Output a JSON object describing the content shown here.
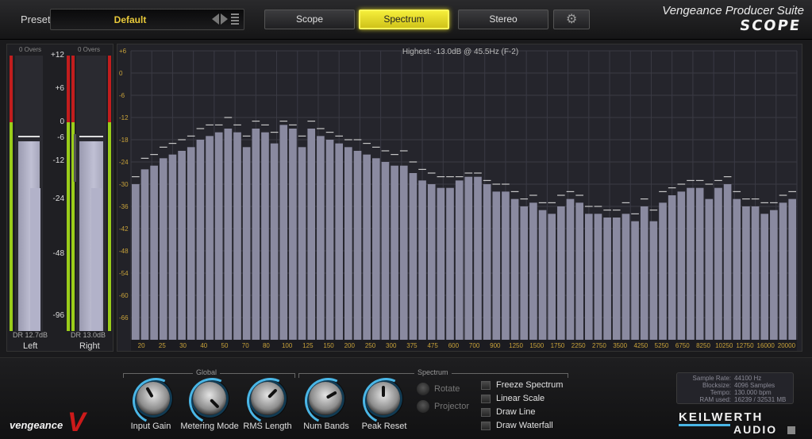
{
  "header": {
    "preset_label": "Preset",
    "preset_name": "Default",
    "tabs": [
      {
        "label": "Scope",
        "active": false
      },
      {
        "label": "Spectrum",
        "active": true
      },
      {
        "label": "Stereo",
        "active": false
      }
    ],
    "settings_icon": "gear-icon",
    "suite_title": "Vengeance Producer Suite",
    "product_logo": "SCOPE"
  },
  "meters": {
    "overs_left": "0 Overs",
    "overs_right": "0 Overs",
    "scale": [
      {
        "label": "+12",
        "db": 12
      },
      {
        "label": "+6",
        "db": 6
      },
      {
        "label": "0",
        "db": 0
      },
      {
        "label": "-6",
        "db": -6
      },
      {
        "label": "-12",
        "db": -12
      },
      {
        "label": "-24",
        "db": -24
      },
      {
        "label": "-48",
        "db": -48
      },
      {
        "label": "-96",
        "db": -96
      }
    ],
    "left": {
      "label": "Left",
      "dr": "DR 12.7dB",
      "level_fraction": 0.69,
      "rms_fraction": 0.52,
      "peak_fraction": 0.71
    },
    "right": {
      "label": "Right",
      "dr": "DR 13.0dB",
      "level_fraction": 0.69,
      "rms_fraction": 0.52,
      "peak_fraction": 0.71
    },
    "colors": {
      "red": "#c21d1d",
      "green": "#9acd1a"
    }
  },
  "spectrum": {
    "highest": "Highest: -13.0dB @ 45.5Hz (F-2)",
    "y_ticks": [
      "+6",
      "0",
      "-6",
      "-12",
      "-18",
      "-24",
      "-30",
      "-36",
      "-42",
      "-48",
      "-54",
      "-60",
      "-66"
    ],
    "x_ticks": [
      "20",
      "25",
      "30",
      "40",
      "50",
      "70",
      "80",
      "100",
      "125",
      "150",
      "200",
      "250",
      "300",
      "375",
      "475",
      "600",
      "700",
      "900",
      "1250",
      "1500",
      "1750",
      "2250",
      "2750",
      "3500",
      "4250",
      "5250",
      "6750",
      "8250",
      "10250",
      "12750",
      "16000",
      "20000"
    ],
    "bar_color": "#8a8aa0",
    "label_color": "#c8a23a"
  },
  "chart_data": {
    "type": "bar",
    "title": "Highest: -13.0dB @ 45.5Hz (F-2)",
    "ylim": [
      -72,
      6
    ],
    "y_ticks": [
      6,
      0,
      -6,
      -12,
      -18,
      -24,
      -30,
      -36,
      -42,
      -48,
      -54,
      -60,
      -66
    ],
    "x_tick_labels": [
      "20",
      "25",
      "30",
      "40",
      "50",
      "70",
      "80",
      "100",
      "125",
      "150",
      "200",
      "250",
      "300",
      "375",
      "475",
      "600",
      "700",
      "900",
      "1250",
      "1500",
      "1750",
      "2250",
      "2750",
      "3500",
      "4250",
      "5250",
      "6750",
      "8250",
      "10250",
      "12750",
      "16000",
      "20000"
    ],
    "values": [
      -30,
      -26,
      -25,
      -23,
      -22,
      -21,
      -20,
      -18,
      -17,
      -16,
      -15,
      -16,
      -20,
      -15,
      -16,
      -19,
      -14,
      -15,
      -20,
      -15,
      -17,
      -18,
      -19,
      -20,
      -21,
      -22,
      -23,
      -24,
      -25,
      -25,
      -27,
      -29,
      -30,
      -31,
      -31,
      -29,
      -28,
      -28,
      -30,
      -32,
      -32,
      -34,
      -36,
      -35,
      -37,
      -38,
      -36,
      -34,
      -35,
      -38,
      -38,
      -39,
      -39,
      -38,
      -40,
      -36,
      -40,
      -35,
      -33,
      -32,
      -31,
      -31,
      -34,
      -31,
      -30,
      -34,
      -36,
      -36,
      -38,
      -37,
      -35,
      -34
    ],
    "peaks": [
      -28,
      -23,
      -22,
      -20,
      -19,
      -18,
      -17,
      -15,
      -14,
      -14,
      -12,
      -14,
      -17,
      -13,
      -14,
      -16,
      -13,
      -14,
      -17,
      -13,
      -15,
      -16,
      -17,
      -18,
      -18,
      -19,
      -20,
      -21,
      -22,
      -21,
      -24,
      -26,
      -27,
      -28,
      -28,
      -28,
      -27,
      -27,
      -29,
      -30,
      -30,
      -32,
      -34,
      -33,
      -35,
      -35,
      -33,
      -32,
      -33,
      -36,
      -36,
      -37,
      -37,
      -35,
      -38,
      -34,
      -37,
      -32,
      -31,
      -30,
      -29,
      -29,
      -30,
      -29,
      -28,
      -32,
      -34,
      -34,
      -35,
      -35,
      -33,
      -32
    ]
  },
  "controls": {
    "global_label": "Global",
    "spectrum_label": "Spectrum",
    "knobs": [
      {
        "label": "Input Gain",
        "angle": -30
      },
      {
        "label": "Metering Mode",
        "angle": 135
      },
      {
        "label": "RMS Length",
        "angle": 45
      },
      {
        "label": "Num Bands",
        "angle": 60
      },
      {
        "label": "Peak Reset",
        "angle": 0
      }
    ],
    "rotate_label": "Rotate",
    "projector_label": "Projector",
    "checkboxes": [
      {
        "label": "Freeze Spectrum",
        "checked": false
      },
      {
        "label": "Linear Scale",
        "checked": false
      },
      {
        "label": "Draw Line",
        "checked": false
      },
      {
        "label": "Draw Waterfall",
        "checked": false
      }
    ]
  },
  "info": {
    "sample_rate_key": "Sample Rate:",
    "sample_rate": "44100 Hz",
    "blocksize_key": "Blocksize:",
    "blocksize": "4096 Samples",
    "tempo_key": "Tempo:",
    "tempo": "130.000 bpm",
    "ram_key": "RAM used:",
    "ram": "16239 / 32531 MB"
  },
  "branding": {
    "vengeance": "vengeance",
    "v_mark": "V",
    "keilwerth_top": "KEILWERTH",
    "keilwerth_bottom": "AUDIO"
  }
}
